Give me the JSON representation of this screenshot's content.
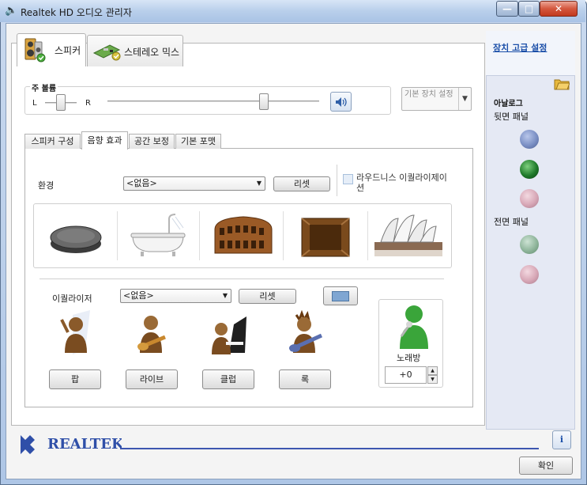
{
  "window": {
    "title": "Realtek HD 오디오 관리자"
  },
  "device_tabs": {
    "speaker": "스피커",
    "stereo_mix": "스테레오 믹스"
  },
  "volume": {
    "group_label": "주 볼륨",
    "left": "L",
    "right": "R",
    "balance": 0.5,
    "level": 0.74,
    "default_device": "기본 장치 설정"
  },
  "sub_tabs": [
    "스피커 구성",
    "음향 효과",
    "공간 보정",
    "기본 포맷"
  ],
  "effects": {
    "environment_label": "환경",
    "environment_value": "<없음>",
    "environment_reset": "리셋",
    "loudness": "라우드니스 이퀄라이제이션",
    "environments": [
      "stone-disc-icon",
      "bathtub-icon",
      "colosseum-icon",
      "stone-room-icon",
      "opera-house-icon"
    ],
    "equalizer_label": "이퀄라이저",
    "equalizer_value": "<없음>",
    "equalizer_reset": "리셋",
    "presets": [
      "팝",
      "라이브",
      "클럽",
      "록"
    ],
    "karaoke_label": "노래방",
    "karaoke_value": "+0"
  },
  "sidebar": {
    "advanced_link": "장치 고급 설정",
    "analog": "아날로그",
    "rear_panel": "뒷면 패널",
    "front_panel": "전면 패널",
    "rear_jacks": [
      "#7a8fc4",
      "#1f7a2a",
      "#d7a7b6"
    ],
    "front_jacks": [
      "#8fb59b",
      "#d7a7b6"
    ]
  },
  "footer": {
    "brand": "REALTEK",
    "ok": "확인"
  }
}
